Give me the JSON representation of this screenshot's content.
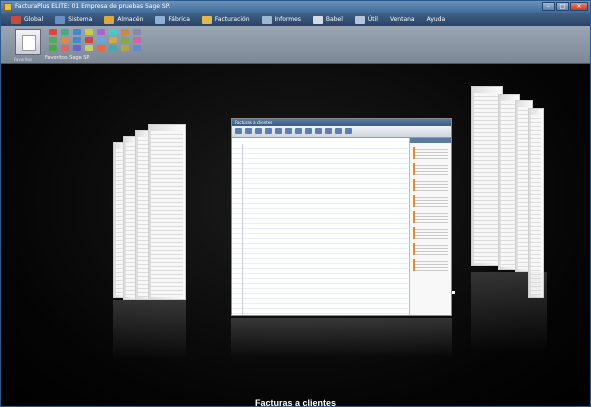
{
  "window": {
    "title": "FacturaPlus ELITE: 01  Empresa de pruebas Sage SP."
  },
  "window_buttons": [
    "–",
    "□",
    "✕"
  ],
  "menu": [
    {
      "label": "Global",
      "icon": "global-icon",
      "color": "#c94a3a"
    },
    {
      "label": "Sistema",
      "icon": "sistema-icon",
      "color": "#6a8fc4"
    },
    {
      "label": "Almacén",
      "icon": "almacen-icon",
      "color": "#e0a83a"
    },
    {
      "label": "Fábrica",
      "icon": "fabrica-icon",
      "color": "#8fb0d8"
    },
    {
      "label": "Facturación",
      "icon": "facturacion-icon",
      "color": "#e0b94a"
    },
    {
      "label": "Informes",
      "icon": "informes-icon",
      "color": "#9fb6d2"
    },
    {
      "label": "Babel",
      "icon": "babel-icon",
      "color": "#d6dce6"
    },
    {
      "label": "Útil",
      "icon": "util-icon",
      "color": "#b8c6d8"
    },
    {
      "label": "Ventana",
      "icon": "",
      "color": ""
    },
    {
      "label": "Ayuda",
      "icon": "",
      "color": ""
    }
  ],
  "ribbon": {
    "group_label": "Favoritos Sage SP",
    "left_label": "Favoritos",
    "icon_colors": [
      "#d44",
      "#4a8",
      "#48c",
      "#cc4",
      "#a6c",
      "#4cc",
      "#c84",
      "#88a",
      "#5a5",
      "#d84",
      "#48c",
      "#c44",
      "#6ad",
      "#ca4",
      "#8a4",
      "#c6a",
      "#4a4",
      "#d66",
      "#66c",
      "#cc6",
      "#e64",
      "#4aa",
      "#aa4",
      "#68c"
    ]
  },
  "flip3d": {
    "caption": "Facturas a clientes",
    "center_window_title": "Facturas a clientes"
  }
}
